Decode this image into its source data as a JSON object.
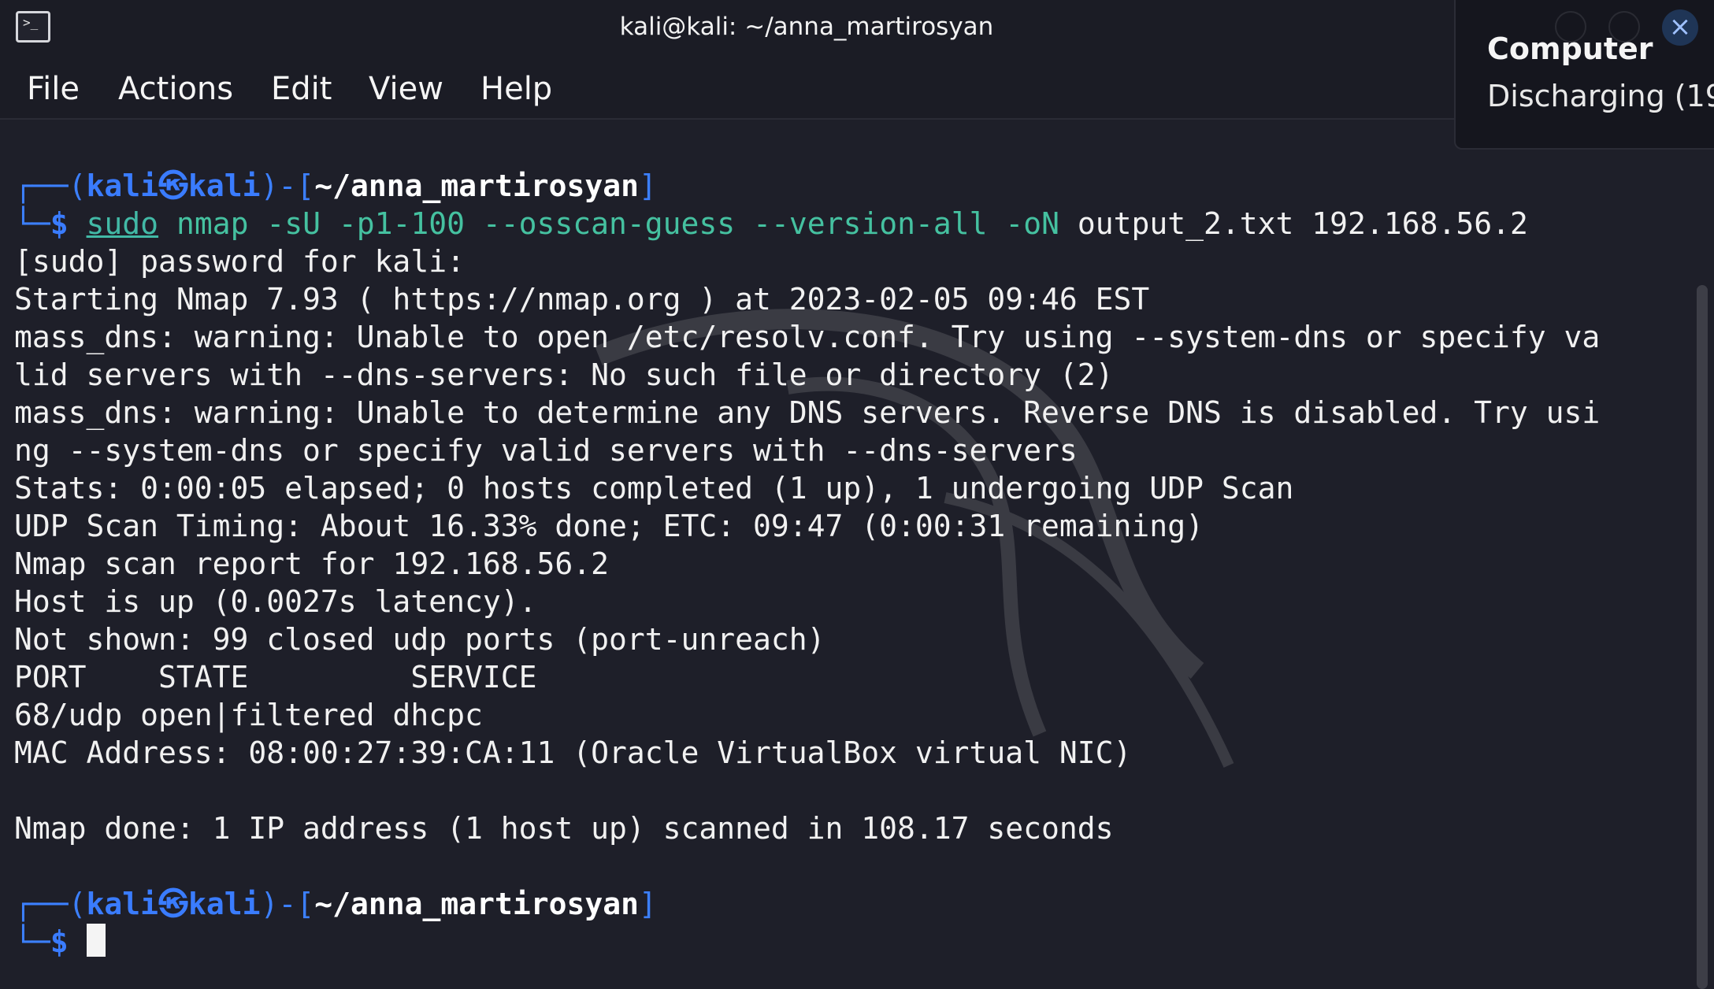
{
  "window": {
    "title": "kali@kali: ~/anna_martirosyan",
    "app_icon": "terminal-icon",
    "app_icon_glyph": ">_"
  },
  "menu": {
    "items": [
      "File",
      "Actions",
      "Edit",
      "View",
      "Help"
    ]
  },
  "notification": {
    "title": "Computer",
    "body": "Discharging (19"
  },
  "terminal": {
    "prompt1": {
      "open": "┌──(",
      "user": "kali",
      "at": "㉿",
      "host": "kali",
      "mid": ")-[",
      "path": "~/anna_martirosyan",
      "close": "]",
      "branch": "└─",
      "dollar": "$",
      "sudo": "sudo",
      "nmap": "nmap",
      "args": "-sU -p1-100 --osscan-guess --version-all -oN",
      "rest": "output_2.txt 192.168.56.2"
    },
    "output": [
      "[sudo] password for kali:",
      "Starting Nmap 7.93 ( https://nmap.org ) at 2023-02-05 09:46 EST",
      "mass_dns: warning: Unable to open /etc/resolv.conf. Try using --system-dns or specify va",
      "lid servers with --dns-servers: No such file or directory (2)",
      "mass_dns: warning: Unable to determine any DNS servers. Reverse DNS is disabled. Try usi",
      "ng --system-dns or specify valid servers with --dns-servers",
      "Stats: 0:00:05 elapsed; 0 hosts completed (1 up), 1 undergoing UDP Scan",
      "UDP Scan Timing: About 16.33% done; ETC: 09:47 (0:00:31 remaining)",
      "Nmap scan report for 192.168.56.2",
      "Host is up (0.0027s latency).",
      "Not shown: 99 closed udp ports (port-unreach)",
      "PORT    STATE         SERVICE",
      "68/udp open|filtered dhcpc",
      "MAC Address: 08:00:27:39:CA:11 (Oracle VirtualBox virtual NIC)",
      "",
      "Nmap done: 1 IP address (1 host up) scanned in 108.17 seconds"
    ],
    "prompt2": {
      "open": "┌──(",
      "user": "kali",
      "at": "㉿",
      "host": "kali",
      "mid": ")-[",
      "path": "~/anna_martirosyan",
      "close": "]",
      "branch": "└─",
      "dollar": "$"
    }
  },
  "colors": {
    "background": "#1e1f29",
    "prompt_blue": "#3a7cff",
    "command_green": "#45c1a0"
  }
}
